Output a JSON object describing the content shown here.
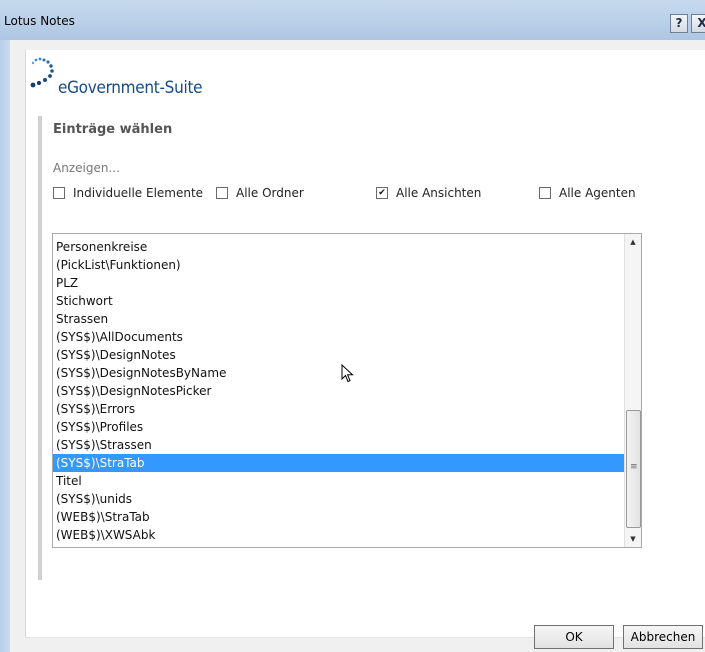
{
  "window": {
    "title": "Lotus Notes",
    "help_label": "?",
    "close_label": "X"
  },
  "brand": {
    "name": "eGovernment-Suite",
    "color": "#174a86"
  },
  "section": {
    "heading": "Einträge wählen",
    "show_label": "Anzeigen..."
  },
  "filters": [
    {
      "label": "Individuelle Elemente",
      "checked": false
    },
    {
      "label": "Alle Ordner",
      "checked": false
    },
    {
      "label": "Alle Ansichten",
      "checked": true
    },
    {
      "label": "Alle Agenten",
      "checked": false
    }
  ],
  "list": {
    "items": [
      "Personenkreise",
      "(PickList\\Funktionen)",
      "PLZ",
      "Stichwort",
      "Strassen",
      "(SYS$)\\AllDocuments",
      "(SYS$)\\DesignNotes",
      "(SYS$)\\DesignNotesByName",
      "(SYS$)\\DesignNotesPicker",
      "(SYS$)\\Errors",
      "(SYS$)\\Profiles",
      "(SYS$)\\Strassen",
      "(SYS$)\\StraTab",
      "Titel",
      "(SYS$)\\unids",
      "(WEB$)\\StraTab",
      "(WEB$)\\XWSAbk"
    ],
    "selected_index": 12,
    "selection_color": "#3399ff"
  },
  "buttons": {
    "ok": "OK",
    "cancel": "Abbrechen"
  }
}
